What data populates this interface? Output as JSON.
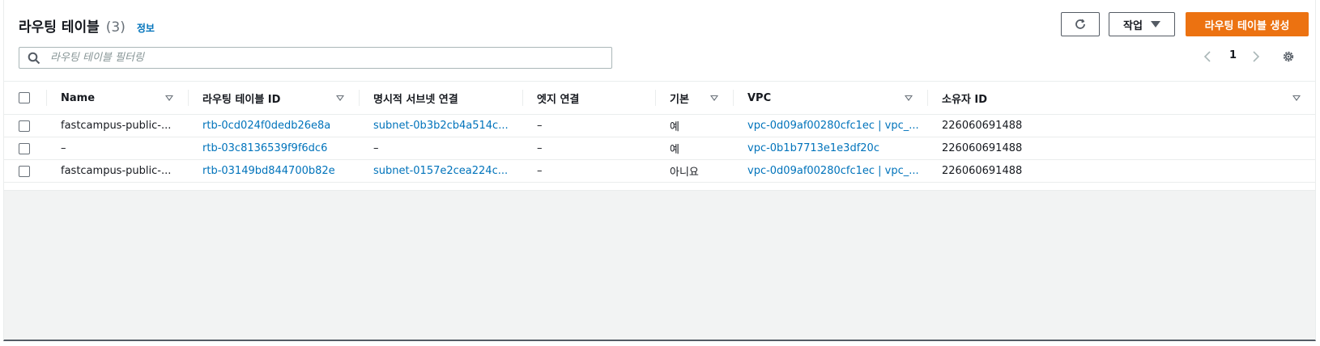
{
  "header": {
    "title": "라우팅 테이블",
    "count": "(3)",
    "info_link": "정보"
  },
  "toolbar": {
    "refresh_icon": "refresh-icon",
    "actions_label": "작업",
    "create_label": "라우팅 테이블 생성"
  },
  "search": {
    "placeholder": "라우팅 테이블 필터링",
    "value": ""
  },
  "pagination": {
    "current_page": "1"
  },
  "table": {
    "columns": {
      "name": "Name",
      "route_table_id": "라우팅 테이블 ID",
      "explicit_subnet": "명시적 서브넷 연결",
      "edge_assoc": "엣지 연결",
      "main": "기본",
      "vpc": "VPC",
      "owner_id": "소유자 ID"
    },
    "rows": [
      {
        "name": "fastcampus-public-...",
        "route_table_id": "rtb-0cd024f0dedb26e8a",
        "explicit_subnet": "subnet-0b3b2cb4a514c...",
        "edge_assoc": "–",
        "main": "예",
        "vpc": "vpc-0d09af00280cfc1ec | vpc_...",
        "owner_id": "226060691488"
      },
      {
        "name": "–",
        "route_table_id": "rtb-03c8136539f9f6dc6",
        "explicit_subnet": "–",
        "edge_assoc": "–",
        "main": "예",
        "vpc": "vpc-0b1b7713e1e3df20c",
        "owner_id": "226060691488"
      },
      {
        "name": "fastcampus-public-...",
        "route_table_id": "rtb-03149bd844700b82e",
        "explicit_subnet": "subnet-0157e2cea224c...",
        "edge_assoc": "–",
        "main": "아니요",
        "vpc": "vpc-0d09af00280cfc1ec | vpc_...",
        "owner_id": "226060691488"
      }
    ]
  },
  "colors": {
    "accent": "#ec7211",
    "link": "#0073bb",
    "text": "#16191f",
    "muted": "#687078"
  }
}
